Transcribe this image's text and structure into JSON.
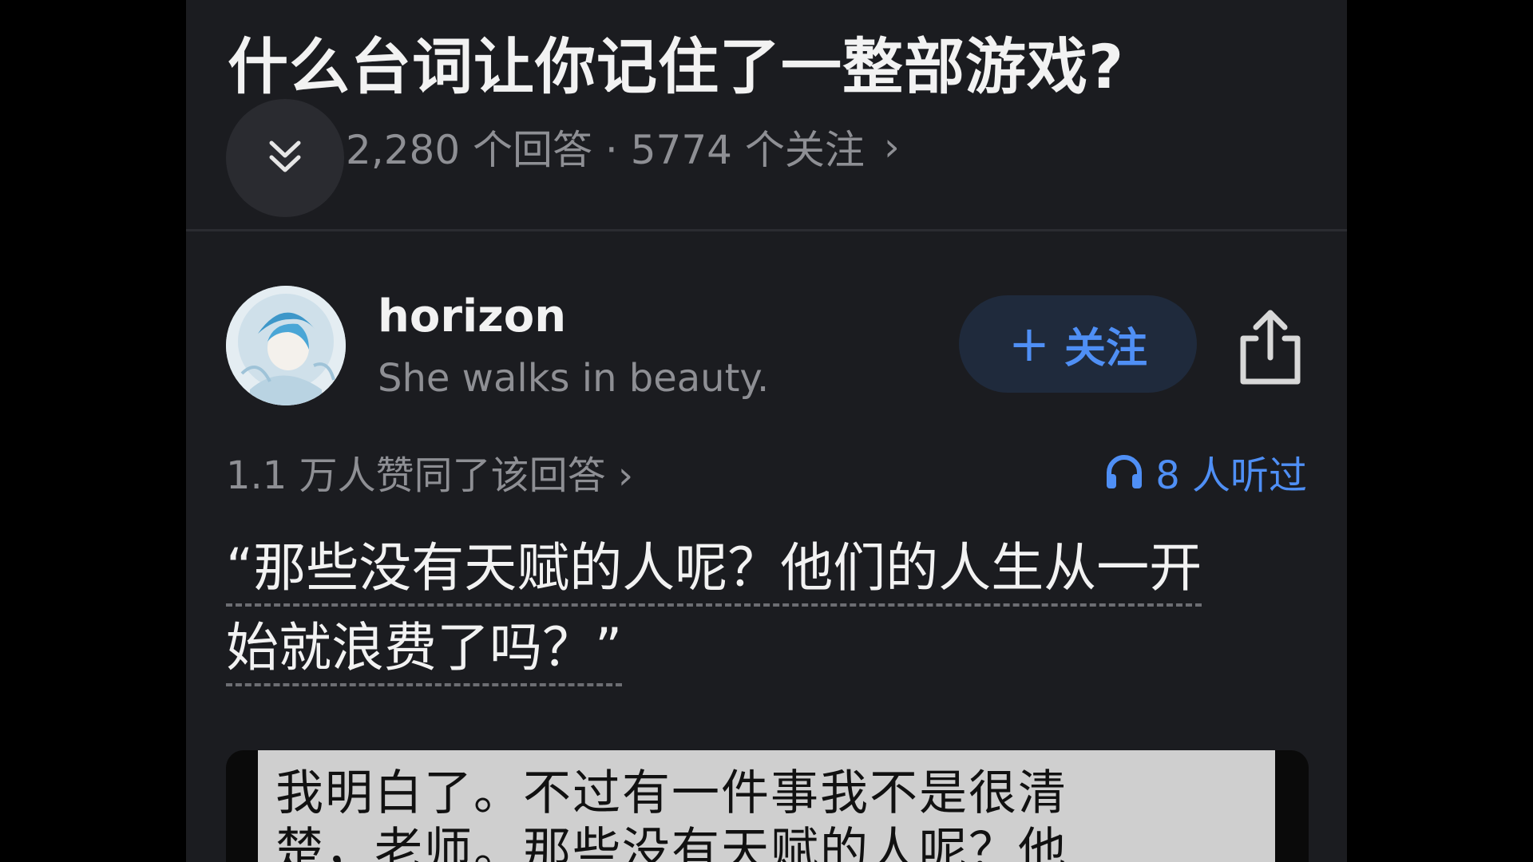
{
  "question": {
    "title": "什么台词让你记住了一整部游戏?",
    "meta": "2,280 个回答 · 5774 个关注",
    "meta_chevron": "›",
    "collapse_icon": "double-chevron-down-icon"
  },
  "answer": {
    "author": {
      "name": "horizon",
      "bio": "She walks in beauty."
    },
    "follow_plus": "+",
    "follow_label": "关注",
    "share_icon": "share-icon",
    "upvotes": "1.1 万人赞同了该回答 ›",
    "listen": "8 人听过",
    "listen_icon": "headphones-icon",
    "quote_line1": "“那些没有天赋的人呢？他们的人生从一开",
    "quote_line2": "始就浪费了吗？”",
    "image_text_line1": "我明白了。不过有一件事我不是很清",
    "image_text_line2": "楚，老师。那些没有天赋的人呢？他"
  },
  "colors": {
    "background": "#1b1c20",
    "accent": "#4f8ff5",
    "text_primary": "#f2f2f2",
    "text_secondary": "#8e8f94"
  }
}
